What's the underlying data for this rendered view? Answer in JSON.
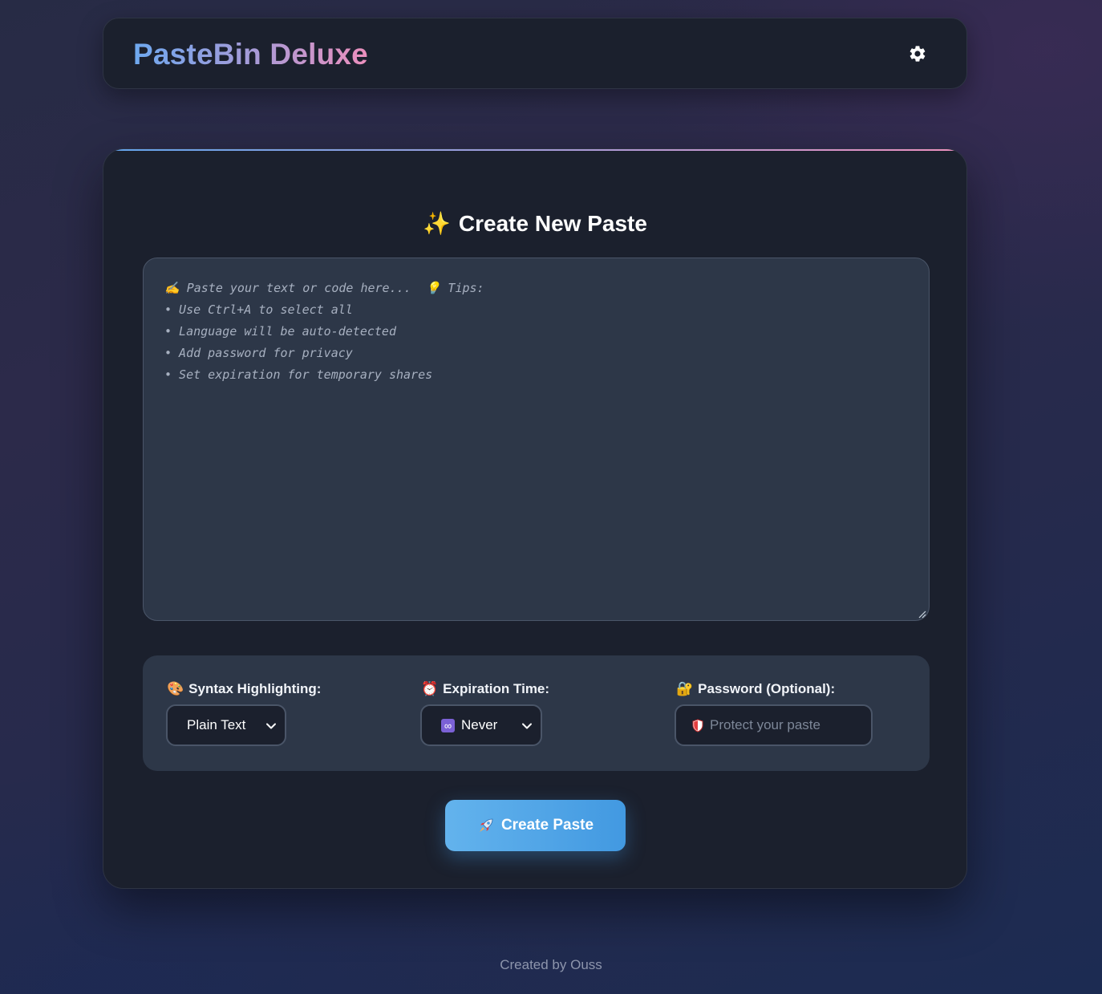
{
  "header": {
    "logo": "PasteBin Deluxe",
    "settings_icon": "gear-icon"
  },
  "card": {
    "title_icon": "✨",
    "title": "Create New Paste",
    "paste_placeholder": "✍️ Paste your text or code here...  💡 Tips:\n• Use Ctrl+A to select all\n• Language will be auto-detected\n• Add password for privacy\n• Set expiration for temporary shares",
    "paste_value": ""
  },
  "options": {
    "syntax": {
      "icon": "🎨",
      "label": "Syntax Highlighting:",
      "selected": "Plain Text"
    },
    "expiration": {
      "icon": "⏰",
      "label": "Expiration Time:",
      "selected_icon": "∞",
      "selected": "Never"
    },
    "password": {
      "icon": "🔐",
      "label": "Password (Optional):",
      "placeholder": "Protect your paste",
      "value": ""
    }
  },
  "create_button": {
    "icon": "rocket-icon",
    "label": "Create Paste"
  },
  "footer": {
    "text": "Created by Ouss"
  },
  "colors": {
    "accent_blue": "#4299e1",
    "gradient_start": "#6ea8ef",
    "gradient_end": "#ec8fbd",
    "surface": "#1b202d",
    "panel": "#2d3748"
  }
}
